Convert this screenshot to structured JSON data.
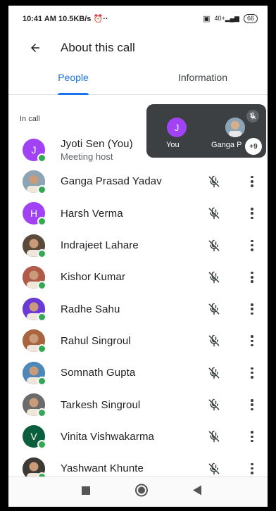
{
  "status": {
    "time": "10:41 AM",
    "speed": "10.5KB/s",
    "signal_label": "40+",
    "battery": "66"
  },
  "header": {
    "title": "About this call"
  },
  "tabs": [
    {
      "label": "People",
      "active": true
    },
    {
      "label": "Information",
      "active": false
    }
  ],
  "section": {
    "label": "In call"
  },
  "participants": [
    {
      "name": "Jyoti Sen (You)",
      "sub": "Meeting host",
      "initial": "J",
      "color": "#a142f4",
      "photo": false
    },
    {
      "name": "Ganga Prasad Yadav",
      "photo": true,
      "color": "#8da4b5"
    },
    {
      "name": "Harsh Verma",
      "initial": "H",
      "color": "#a142f4",
      "photo": false
    },
    {
      "name": "Indrajeet Lahare",
      "photo": true,
      "color": "#5b4a3c"
    },
    {
      "name": "Kishor Kumar",
      "photo": true,
      "color": "#b05a4a"
    },
    {
      "name": "Radhe Sahu",
      "photo": true,
      "color": "#6a3bd6"
    },
    {
      "name": "Rahul Singroul",
      "photo": true,
      "color": "#a8653f"
    },
    {
      "name": "Somnath Gupta",
      "photo": true,
      "color": "#4d88b8"
    },
    {
      "name": "Tarkesh Singroul",
      "photo": true,
      "color": "#6b6b6b"
    },
    {
      "name": "Vinita Vishwakarma",
      "initial": "V",
      "color": "#0b5e3e",
      "photo": false
    },
    {
      "name": "Yashwant Khunte",
      "photo": true,
      "color": "#3d3a36"
    }
  ],
  "pip": {
    "you_initial": "J",
    "you_label": "You",
    "other_label": "Ganga P",
    "more_count": "+9"
  },
  "colors": {
    "accent": "#1a73e8",
    "online": "#34a853",
    "pip_bg": "#3c4043"
  },
  "icons": {
    "back": "arrow-left-icon",
    "mute": "mic-off-icon",
    "more": "more-vert-icon"
  }
}
